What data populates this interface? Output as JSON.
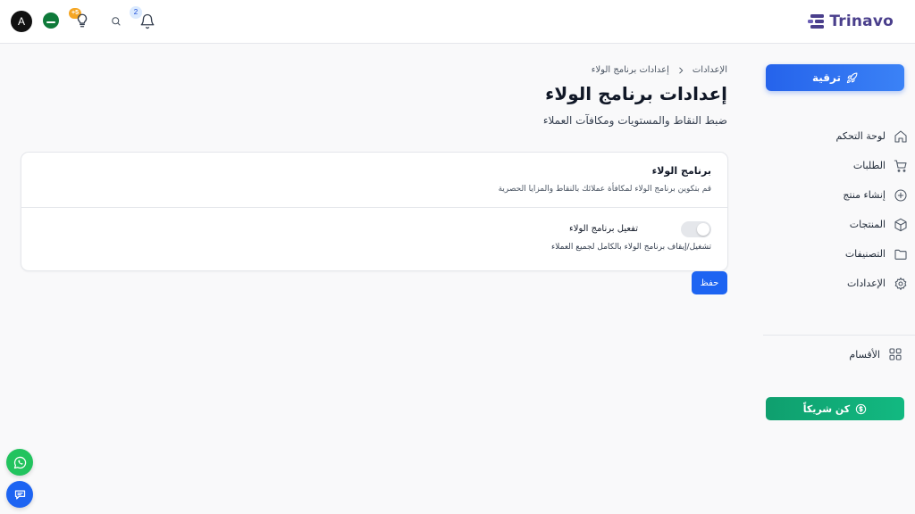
{
  "header": {
    "logo_text": "Trinavo",
    "avatar_letter": "A",
    "bulb_badge": "+5",
    "notifications_count": "2",
    "icons": [
      "avatar",
      "saudi-flag-icon",
      "lightbulb-icon",
      "search-icon",
      "bell-icon",
      "trinavo-logo-icon"
    ]
  },
  "sidebar": {
    "upgrade_label": "ترقية",
    "items": [
      {
        "label": "لوحة التحكم",
        "icon": "home-icon"
      },
      {
        "label": "الطلبات",
        "icon": "cart-icon"
      },
      {
        "label": "إنشاء منتج",
        "icon": "plus-circle-icon"
      },
      {
        "label": "المنتجات",
        "icon": "box-icon"
      },
      {
        "label": "التصنيفات",
        "icon": "folder-icon"
      },
      {
        "label": "الإعدادات",
        "icon": "gear-icon"
      }
    ],
    "sections_label": "الأقسام",
    "partner_label": "كن شريكاً"
  },
  "main": {
    "breadcrumb": [
      "الإعدادات",
      "إعدادات برنامج الولاء"
    ],
    "title": "إعدادات برنامج الولاء",
    "subtitle": "ضبط النقاط والمستويات ومكافآت العملاء",
    "card": {
      "title": "برنامج الولاء",
      "description": "قم بتكوين برنامج الولاء لمكافأة عملائك بالنقاط والمزايا الحصرية",
      "toggle_label": "تفعيل برنامج الولاء",
      "toggle_description": "تشغيل/إيقاف برنامج الولاء بالكامل لجميع العملاء",
      "toggle_enabled": false
    },
    "save_label": "حفظ"
  },
  "colors": {
    "primary": "#1d64f2",
    "partner": "#10b981",
    "logo": "#4a3f8c",
    "whatsapp": "#22c35e"
  }
}
